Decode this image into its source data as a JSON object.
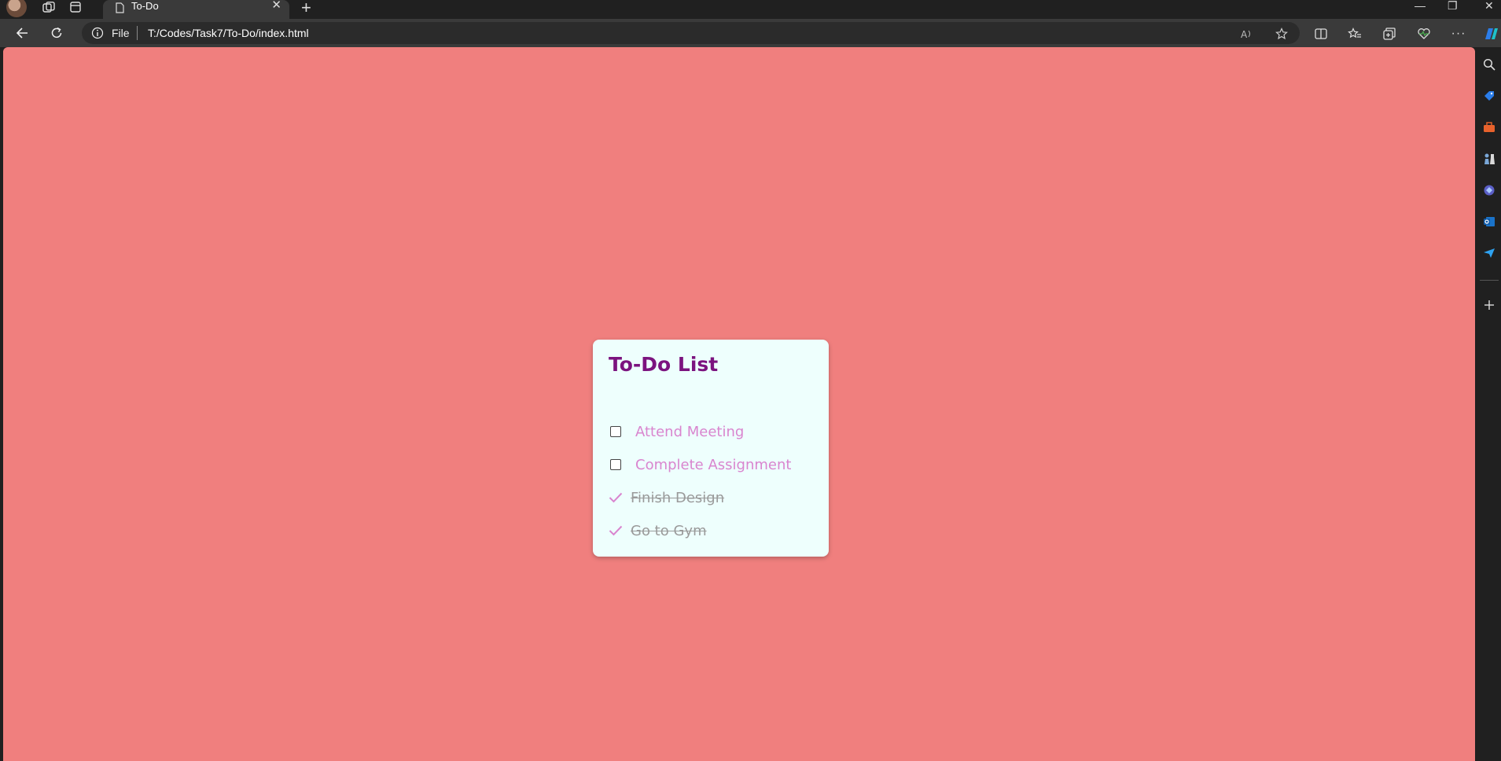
{
  "browser": {
    "tab": {
      "title": "To-Do",
      "close": "✕"
    },
    "new_tab": "+",
    "window": {
      "minimize": "—",
      "restore": "❐",
      "close": "✕"
    },
    "address": {
      "scheme": "File",
      "url": "T:/Codes/Task7/To-Do/index.html"
    },
    "more": "···"
  },
  "page": {
    "background_color": "#f07f7e",
    "card": {
      "title": "To-Do List",
      "title_color": "#7b137f",
      "todos": [
        {
          "text": "Attend Meeting",
          "done": false
        },
        {
          "text": "Complete Assignment",
          "done": false
        },
        {
          "text": "Finish Design",
          "done": true
        },
        {
          "text": "Go to Gym",
          "done": true
        }
      ]
    }
  },
  "sidebar": {
    "icons": [
      "search-icon",
      "tag-icon",
      "toolbox-icon",
      "chess-icon",
      "copilot-icon",
      "outlook-icon",
      "send-icon",
      "plus-icon"
    ]
  }
}
